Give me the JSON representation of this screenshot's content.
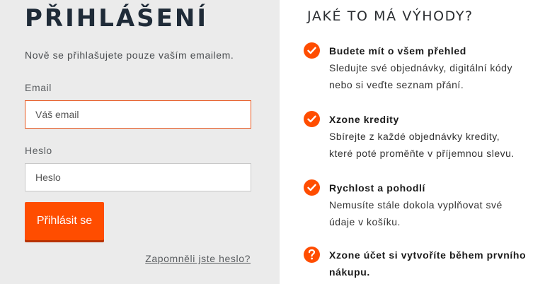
{
  "login": {
    "title": "PŘIHLÁŠENÍ",
    "intro": "Nově se přihlašujete pouze vaším emailem.",
    "email_label": "Email",
    "email_placeholder": "Váš email",
    "password_label": "Heslo",
    "password_placeholder": "Heslo",
    "submit_label": "Přihlásit se",
    "forgot_link": "Zapomněli jste heslo?"
  },
  "benefits": {
    "title": "JAKÉ TO MÁ VÝHODY?",
    "items": [
      {
        "icon": "check-icon",
        "title": "Budete mít o všem přehled",
        "lines": [
          "Sledujte své objednávky, digitální kódy",
          "nebo si veďte seznam přání."
        ]
      },
      {
        "icon": "check-icon",
        "title": "Xzone kredity",
        "lines": [
          "Sbírejte z každé objednávky kredity,",
          "které poté proměňte v příjemnou slevu."
        ]
      },
      {
        "icon": "check-icon",
        "title": "Rychlost a pohodlí",
        "lines": [
          "Nemusíte stále dokola vyplňovat své",
          "údaje v košíku."
        ]
      },
      {
        "icon": "question-icon",
        "title": "Xzone účet si vytvoříte během prvního",
        "lines": [
          "nákupu."
        ]
      }
    ]
  },
  "colors": {
    "accent": "#ff4d00",
    "left_panel_bg": "#ebebeb",
    "title_color": "#1f2b38"
  }
}
